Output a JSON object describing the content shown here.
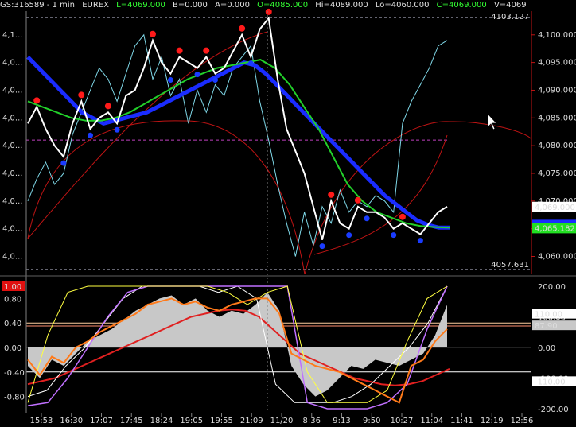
{
  "header": {
    "symbol": "GS:316589 - 1 min",
    "exchange": "EUREX",
    "last": "L=4069.000",
    "bid": "B=0.000",
    "ask": "A=0.000",
    "open": "O=4085.000",
    "high": "Hi=4089.000",
    "low": "Lo=4060.000",
    "close": "C=4069.000",
    "volume": "V=4069"
  },
  "colors": {
    "background": "#000000",
    "price": "#ffffff",
    "cyan_line": "#7fd8e8",
    "ma_blue": "#1a2cff",
    "ma_green": "#22d02a",
    "red_curve": "#c01414",
    "marker_red": "#ff1a1a",
    "marker_blue": "#1a3cff",
    "magenta_level": "#c040c0",
    "osc_fill": "#c8c8c8",
    "orange": "#ff7a1a",
    "yellow": "#ffff40",
    "white_osc": "#ffffff",
    "violet": "#c070ff"
  },
  "chart_data": [
    {
      "type": "line",
      "panel": "price",
      "ylim": [
        4057.631,
        4103.127
      ],
      "y_ticks": [
        "4,100.000",
        "4,095.000",
        "4,090.000",
        "4,085.000",
        "4,080.000",
        "4,075.000",
        "4,070.000",
        "4,065.000",
        "4,060.000"
      ],
      "y_tick_values": [
        4100,
        4095,
        4090,
        4085,
        4080,
        4075,
        4070,
        4065,
        4060
      ],
      "left_ticks": [
        "4,1...",
        "4,0...",
        "4,0...",
        "4,0...",
        "4,0...",
        "4,0...",
        "4,0...",
        "4,0...",
        "4,0..."
      ],
      "top_level": "4103.127",
      "bottom_level": "4057.631",
      "magenta_level": 4081.0,
      "last_price_label": "4,069.000",
      "ma_label": "4,065.182",
      "last_price": 4069.0,
      "ma_value": 4065.182,
      "series": [
        {
          "key": "price",
          "values": [
            4084,
            4087,
            4083,
            4080,
            4078,
            4084,
            4088,
            4083,
            4085,
            4086,
            4084,
            4089,
            4090,
            4094,
            4099,
            4095,
            4093,
            4096,
            4095,
            4094,
            4096,
            4093,
            4094,
            4097,
            4100,
            4096,
            4101,
            4103,
            4092,
            4083,
            4079,
            4075,
            4069,
            4063,
            4070,
            4066,
            4065,
            4069,
            4068,
            4068,
            4067,
            4065,
            4066,
            4065,
            4064,
            4066,
            4068,
            4069
          ]
        },
        {
          "key": "cyan",
          "values": [
            4070,
            4074,
            4077,
            4073,
            4075,
            4082,
            4086,
            4090,
            4094,
            4092,
            4088,
            4093,
            4098,
            4100,
            4092,
            4096,
            4089,
            4092,
            4084,
            4090,
            4086,
            4091,
            4089,
            4094,
            4096,
            4098,
            4088,
            4081,
            4073,
            4066,
            4060,
            4068,
            4062,
            4069,
            4066,
            4072,
            4068,
            4070,
            4069,
            4071,
            4070,
            4068,
            4084,
            4088,
            4091,
            4094,
            4098,
            4099
          ]
        },
        {
          "key": "ma_blue",
          "values": [
            4096,
            4094,
            4092,
            4090,
            4088,
            4086,
            4085,
            4084,
            4084.5,
            4085,
            4085.5,
            4086,
            4087,
            4088,
            4089,
            4090,
            4091,
            4092,
            4093,
            4094,
            4095,
            4094.5,
            4093,
            4091,
            4089,
            4087,
            4085,
            4083,
            4081,
            4079,
            4077,
            4075,
            4073,
            4071,
            4069.5,
            4068,
            4066.5,
            4065.7,
            4065.2,
            4065.2
          ]
        },
        {
          "key": "ma_green",
          "values": [
            4088,
            4087,
            4086,
            4085,
            4084.5,
            4084.5,
            4085,
            4086,
            4087.5,
            4089,
            4090.5,
            4092,
            4093,
            4094,
            4094.5,
            4095,
            4095.5,
            4094,
            4091,
            4087,
            4083,
            4078,
            4073,
            4070,
            4068,
            4067,
            4066,
            4065.5,
            4065.3,
            4065.2
          ]
        }
      ]
    },
    {
      "type": "line",
      "panel": "oscillator",
      "ylim": [
        -1.0,
        1.0
      ],
      "left_ticks": [
        "1.00",
        "0.80",
        "0.40",
        "0.00",
        "-0.40",
        "-0.80"
      ],
      "left_tick_values": [
        1.0,
        0.8,
        0.4,
        0.0,
        -0.4,
        -0.8
      ],
      "right_ticks": [
        "200.00",
        "100.00",
        "0.00",
        "-100.00",
        "-200.00"
      ],
      "right_tick_values": [
        200,
        100,
        0,
        -100,
        -200
      ],
      "right_labels": [
        "110.00",
        "87.90",
        "-110.00"
      ],
      "right_label_values": [
        110,
        87.9,
        -110
      ],
      "series": [
        {
          "key": "fill",
          "values": [
            -0.3,
            -0.5,
            -0.2,
            -0.3,
            -0.1,
            0.1,
            0.2,
            0.3,
            0.45,
            0.6,
            0.7,
            0.8,
            0.85,
            0.7,
            0.8,
            0.6,
            0.5,
            0.6,
            0.55,
            0.7,
            0.9,
            0.6,
            -0.3,
            -0.6,
            -0.8,
            -0.7,
            -0.5,
            -0.3,
            -0.35,
            -0.2,
            -0.25,
            -0.3,
            -0.2,
            -0.1,
            0.2,
            0.7
          ]
        },
        {
          "key": "orange",
          "values": [
            -0.2,
            -0.45,
            -0.15,
            -0.25,
            0.0,
            0.1,
            0.25,
            0.35,
            0.45,
            0.55,
            0.7,
            0.75,
            0.8,
            0.7,
            0.75,
            0.65,
            0.6,
            0.7,
            0.75,
            0.8,
            0.8,
            0.55,
            -0.1,
            -0.2,
            -0.3,
            -0.35,
            -0.4,
            -0.5,
            -0.6,
            -0.7,
            -0.8,
            -0.9,
            -0.3,
            -0.2,
            0.1,
            0.3
          ]
        },
        {
          "key": "red_smooth",
          "values": [
            -0.6,
            -0.55,
            -0.5,
            -0.4,
            -0.3,
            -0.2,
            -0.1,
            0.0,
            0.1,
            0.2,
            0.3,
            0.4,
            0.5,
            0.55,
            0.6,
            0.62,
            0.6,
            0.5,
            0.3,
            0.1,
            -0.1,
            -0.2,
            -0.3,
            -0.4,
            -0.5,
            -0.55,
            -0.6,
            -0.62,
            -0.6,
            -0.55,
            -0.45,
            -0.35
          ]
        },
        {
          "key": "white_osc",
          "values": [
            -0.8,
            -0.7,
            -0.3,
            0.0,
            0.4,
            0.8,
            1.0,
            1.0,
            1.0,
            1.0,
            0.9,
            1.0,
            0.8,
            -0.6,
            -0.9,
            -0.9,
            -0.9,
            -0.8,
            -0.6,
            -0.3,
            0.0,
            0.4,
            1.0
          ]
        },
        {
          "key": "yellow",
          "values": [
            -0.9,
            0.2,
            0.9,
            1.0,
            1.0,
            1.0,
            1.0,
            1.0,
            1.0,
            1.0,
            0.9,
            0.7,
            0.9,
            1.0,
            -0.4,
            -0.9,
            -0.9,
            -0.9,
            -0.7,
            0.1,
            0.8,
            1.0
          ]
        },
        {
          "key": "violet",
          "values": [
            -0.95,
            -0.9,
            -0.5,
            0.0,
            0.5,
            0.9,
            1.0,
            1.0,
            1.0,
            1.0,
            1.0,
            1.0,
            1.0,
            1.0,
            -0.9,
            -1.0,
            -1.0,
            -1.0,
            -0.9,
            -0.6,
            0.3,
            1.0
          ]
        }
      ]
    }
  ],
  "x_ticks": [
    "15:53",
    "16:30",
    "17:07",
    "17:45",
    "18:24",
    "19:05",
    "19:55",
    "21:09",
    "11/20",
    "8:36",
    "9:13",
    "9:50",
    "10:27",
    "11:04",
    "11:41",
    "12:19",
    "12:56"
  ]
}
